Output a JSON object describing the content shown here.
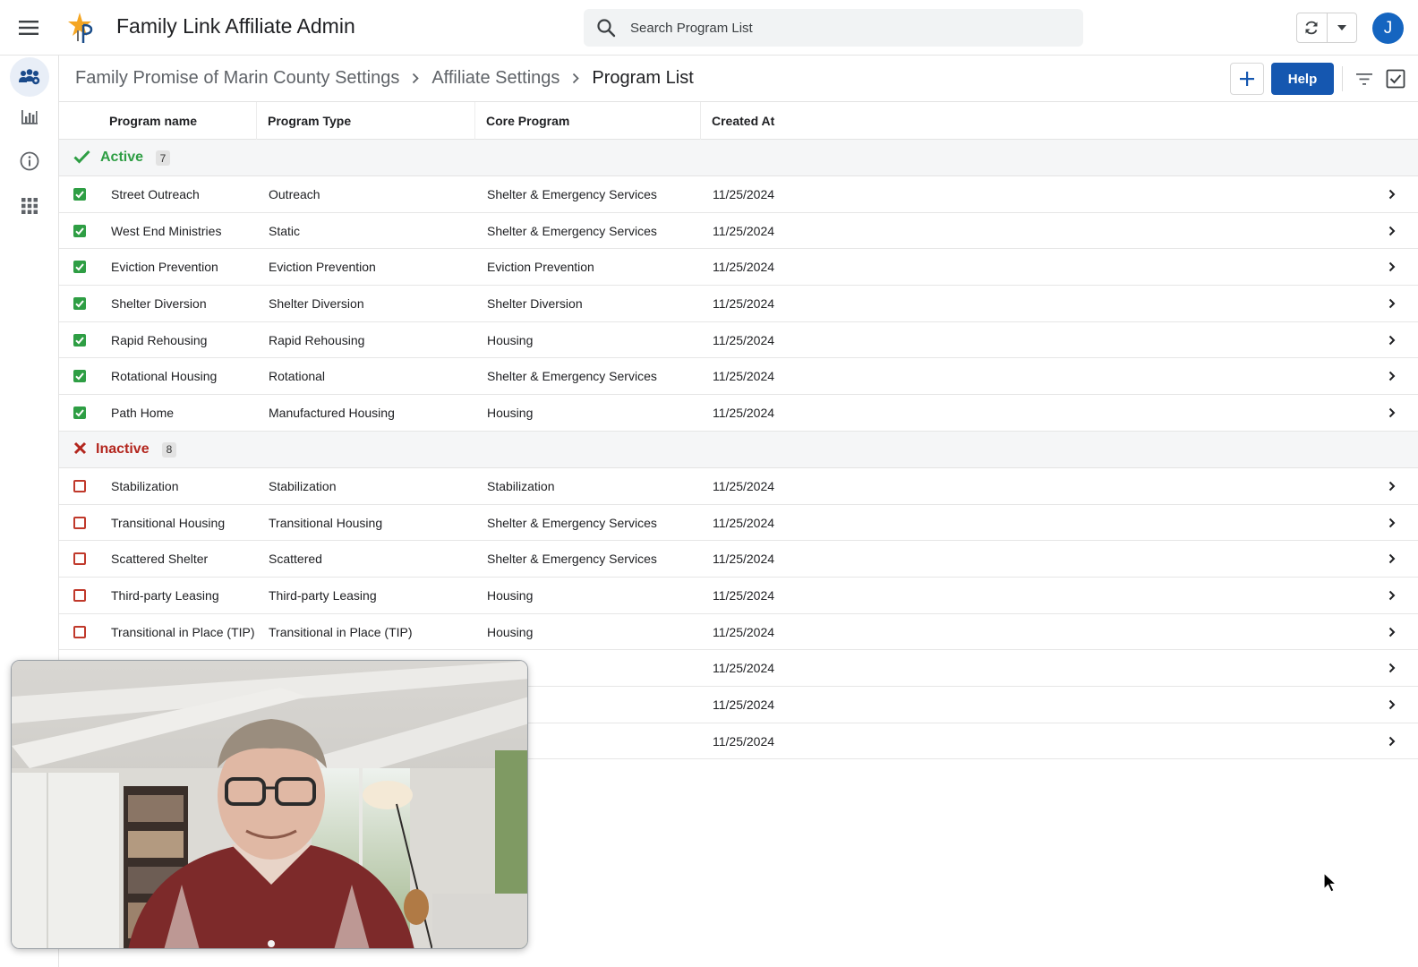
{
  "app": {
    "title": "Family Link Affiliate Admin",
    "avatar_initial": "J",
    "accent": "#1557b0"
  },
  "search": {
    "placeholder": "Search Program List",
    "value": ""
  },
  "breadcrumb": {
    "items": [
      "Family Promise of Marin County Settings",
      "Affiliate Settings",
      "Program List"
    ]
  },
  "toolbar": {
    "help_label": "Help"
  },
  "rail": {
    "icons": [
      "affiliate-settings-icon",
      "reports-icon",
      "info-icon",
      "apps-grid-icon"
    ]
  },
  "table": {
    "columns": [
      "Program name",
      "Program Type",
      "Core Program",
      "Created At"
    ],
    "groups": {
      "active": {
        "label": "Active",
        "count": "7",
        "color": "#2e9e44",
        "rows": [
          {
            "name": "Street Outreach",
            "type": "Outreach",
            "core": "Shelter & Emergency Services",
            "created": "11/25/2024"
          },
          {
            "name": "West End Ministries",
            "type": "Static",
            "core": "Shelter & Emergency Services",
            "created": "11/25/2024"
          },
          {
            "name": "Eviction Prevention",
            "type": "Eviction Prevention",
            "core": "Eviction Prevention",
            "created": "11/25/2024"
          },
          {
            "name": "Shelter Diversion",
            "type": "Shelter Diversion",
            "core": "Shelter Diversion",
            "created": "11/25/2024"
          },
          {
            "name": "Rapid Rehousing",
            "type": "Rapid Rehousing",
            "core": "Housing",
            "created": "11/25/2024"
          },
          {
            "name": "Rotational Housing",
            "type": "Rotational",
            "core": "Shelter & Emergency Services",
            "created": "11/25/2024"
          },
          {
            "name": "Path Home",
            "type": "Manufactured Housing",
            "core": "Housing",
            "created": "11/25/2024"
          }
        ]
      },
      "inactive": {
        "label": "Inactive",
        "count": "8",
        "color": "#b3261e",
        "rows": [
          {
            "name": "Stabilization",
            "type": "Stabilization",
            "core": "Stabilization",
            "created": "11/25/2024"
          },
          {
            "name": "Transitional Housing",
            "type": "Transitional Housing",
            "core": "Shelter & Emergency Services",
            "created": "11/25/2024"
          },
          {
            "name": "Scattered Shelter",
            "type": "Scattered",
            "core": "Shelter & Emergency Services",
            "created": "11/25/2024"
          },
          {
            "name": "Third-party Leasing",
            "type": "Third-party Leasing",
            "core": "Housing",
            "created": "11/25/2024"
          },
          {
            "name": "Transitional in Place (TIP)",
            "type": "Transitional in Place (TIP)",
            "core": "Housing",
            "created": "11/25/2024"
          },
          {
            "name": "",
            "type": "",
            "core": "ng",
            "created": "11/25/2024"
          },
          {
            "name": "",
            "type": "",
            "core": "ng",
            "created": "11/25/2024"
          },
          {
            "name": "",
            "type": "",
            "core": "ng",
            "created": "11/25/2024"
          }
        ]
      }
    }
  }
}
